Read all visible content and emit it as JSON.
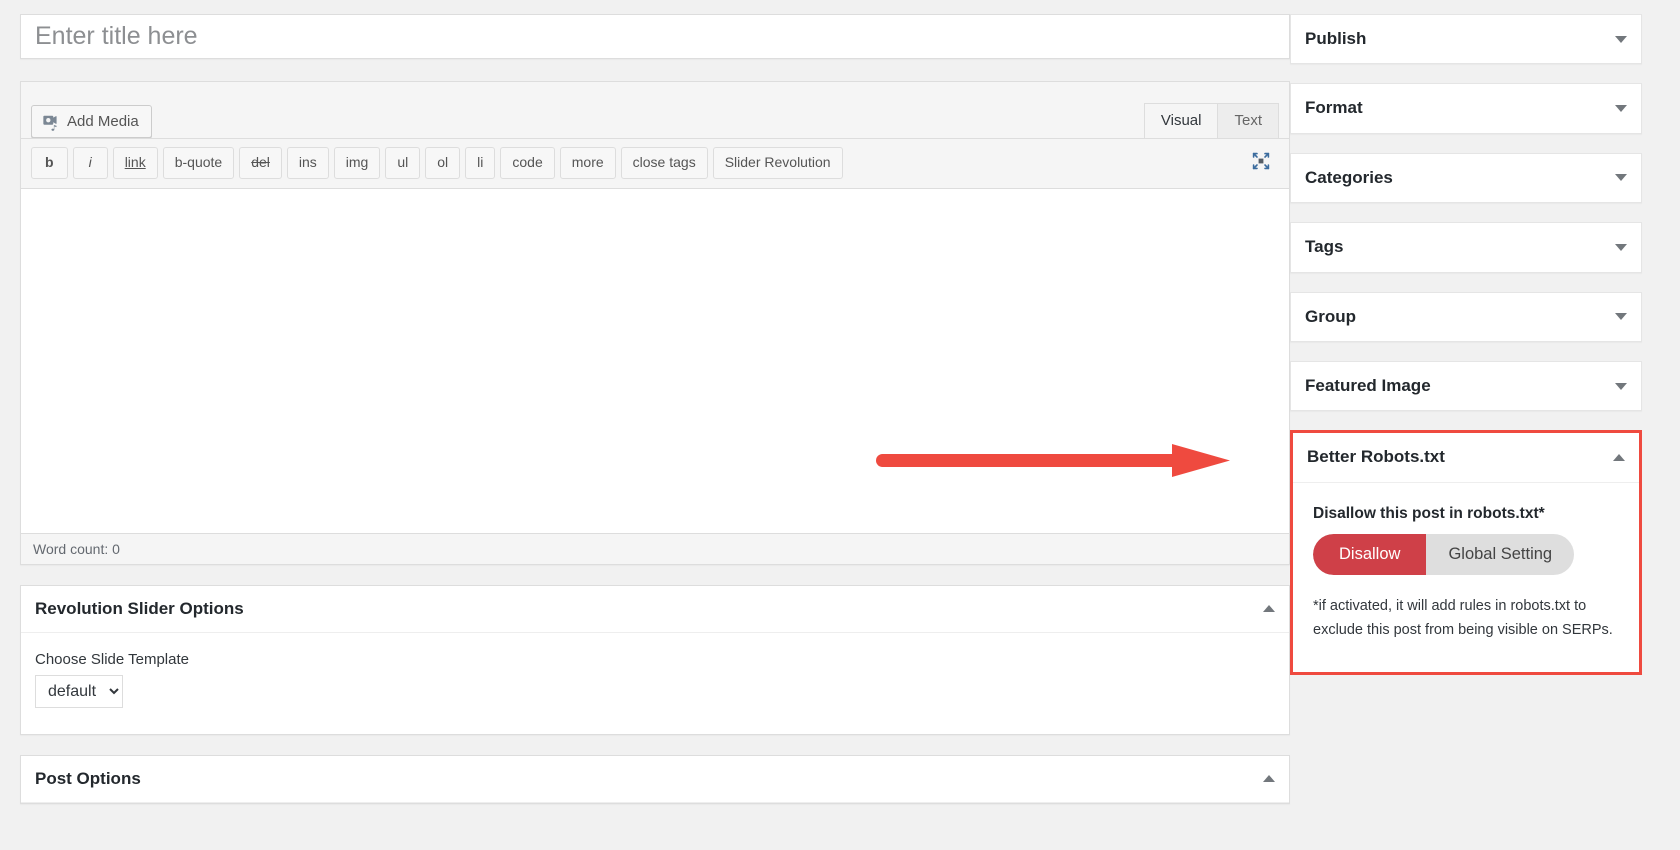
{
  "editor": {
    "title_placeholder": "Enter title here",
    "title_value": "",
    "add_media_label": "Add Media",
    "mode_tabs": [
      {
        "label": "Visual",
        "active": true
      },
      {
        "label": "Text",
        "active": false
      }
    ],
    "quicktags": [
      {
        "label": "b",
        "name": "bold"
      },
      {
        "label": "i",
        "name": "italic"
      },
      {
        "label": "link",
        "name": "link"
      },
      {
        "label": "b-quote",
        "name": "blockquote"
      },
      {
        "label": "del",
        "name": "del"
      },
      {
        "label": "ins",
        "name": "ins"
      },
      {
        "label": "img",
        "name": "img"
      },
      {
        "label": "ul",
        "name": "ul"
      },
      {
        "label": "ol",
        "name": "ol"
      },
      {
        "label": "li",
        "name": "li"
      },
      {
        "label": "code",
        "name": "code"
      },
      {
        "label": "more",
        "name": "more"
      },
      {
        "label": "close tags",
        "name": "close-tags"
      },
      {
        "label": "Slider Revolution",
        "name": "slider-revolution"
      }
    ],
    "content_value": "",
    "word_count": "Word count: 0"
  },
  "slider_panel": {
    "title": "Revolution Slider Options",
    "field_label": "Choose Slide Template",
    "select_value": "default",
    "select_options": [
      "default"
    ]
  },
  "post_options_panel": {
    "title": "Post Options"
  },
  "sidebar": {
    "metaboxes": [
      {
        "title": "Publish",
        "state": "collapsed"
      },
      {
        "title": "Format",
        "state": "collapsed"
      },
      {
        "title": "Categories",
        "state": "collapsed"
      },
      {
        "title": "Tags",
        "state": "collapsed"
      },
      {
        "title": "Group",
        "state": "collapsed"
      },
      {
        "title": "Featured Image",
        "state": "collapsed"
      }
    ],
    "robots_box": {
      "title": "Better Robots.txt",
      "state": "expanded",
      "setting_label": "Disallow this post in robots.txt*",
      "toggle": {
        "on_label": "Disallow",
        "off_label": "Global Setting",
        "selected": "Disallow"
      },
      "note": "*if activated, it will add rules in robots.txt to exclude this post from being visible on SERPs."
    }
  },
  "annotation": {
    "type": "arrow",
    "direction": "right",
    "color": "#ef4a3f",
    "points_to": "Better Robots.txt"
  },
  "colors": {
    "page_background": "#f1f1f1",
    "panel_background": "#ffffff",
    "highlight_red": "#ef4a3f",
    "toggle_active_red": "#cf4048",
    "toggle_inactive_gray": "#dedede",
    "text_dark": "#23282d",
    "border_gray": "#dddddd"
  }
}
